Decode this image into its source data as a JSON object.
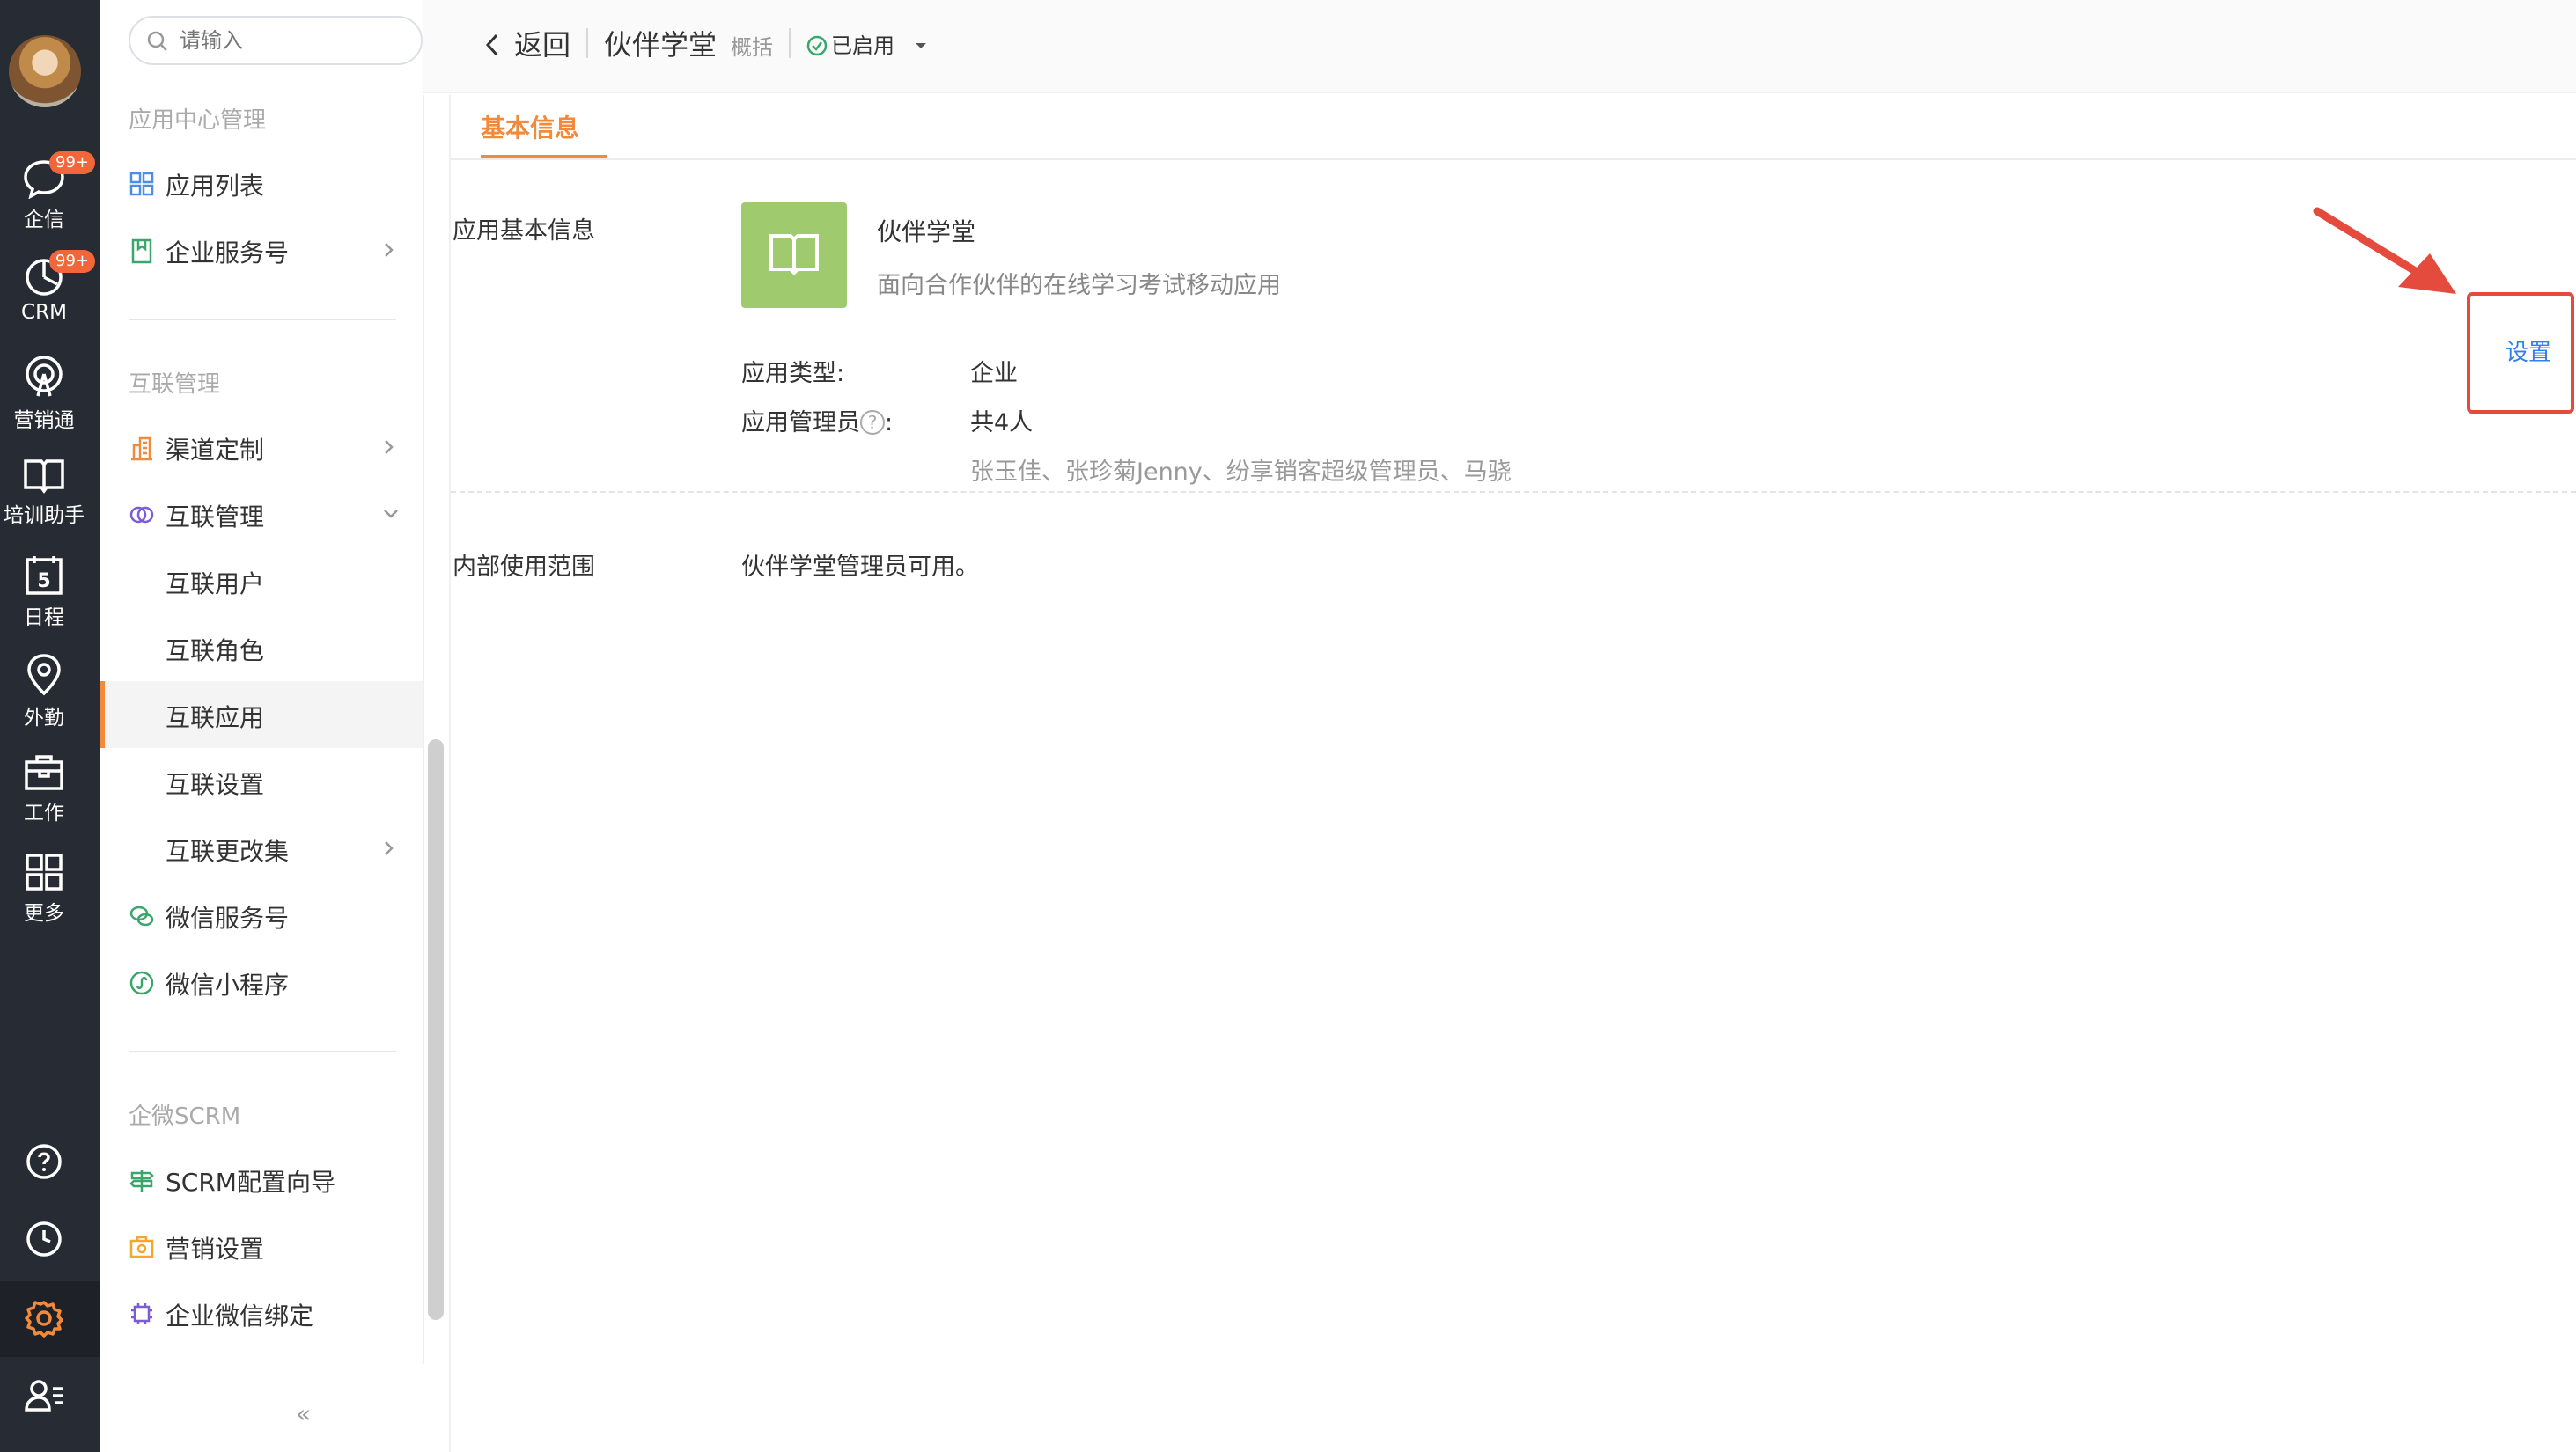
{
  "rail": {
    "items": [
      {
        "label": "企信",
        "badge": "99+",
        "icon": "chat-bubble-icon"
      },
      {
        "label": "CRM",
        "badge": "99+",
        "icon": "pie-clock-icon"
      },
      {
        "label": "营销通",
        "icon": "broadcast-icon"
      },
      {
        "label": "培训助手",
        "icon": "open-book-icon"
      },
      {
        "label": "日程",
        "icon": "calendar-icon",
        "calendar_day": "5"
      },
      {
        "label": "外勤",
        "icon": "location-pin-icon"
      },
      {
        "label": "工作",
        "icon": "briefcase-icon"
      },
      {
        "label": "更多",
        "icon": "grid-icon"
      }
    ]
  },
  "search": {
    "placeholder": "请输入"
  },
  "nav": {
    "section1": "应用中心管理",
    "app_list": "应用列表",
    "enterprise_service": "企业服务号",
    "section2": "互联管理",
    "channel_custom": "渠道定制",
    "interconnect_manage": "互联管理",
    "interconnect_users": "互联用户",
    "interconnect_roles": "互联角色",
    "interconnect_apps": "互联应用",
    "interconnect_settings": "互联设置",
    "interconnect_changeset": "互联更改集",
    "wechat_service": "微信服务号",
    "wechat_miniprogram": "微信小程序",
    "section3": "企微SCRM",
    "scrm_wizard": "SCRM配置向导",
    "marketing_settings": "营销设置",
    "wecom_binding": "企业微信绑定",
    "collapse": "«"
  },
  "header": {
    "back": "返回",
    "app_title": "伙伴学堂",
    "app_sub": "概括",
    "status": "已启用"
  },
  "tabs": {
    "basic_info": "基本信息"
  },
  "content": {
    "basic_label": "应用基本信息",
    "app_name": "伙伴学堂",
    "app_desc": "面向合作伙伴的在线学习考试移动应用",
    "type_key": "应用类型:",
    "type_val": "企业",
    "admin_key": "应用管理员",
    "admin_colon": ":",
    "help_glyph": "?",
    "admin_count": "共4人",
    "admin_names": "张玉佳、张珍菊Jenny、纷享销客超级管理员、马骁",
    "scope_label": "内部使用范围",
    "scope_value": "伙伴学堂管理员可用。",
    "settings_button": "设置"
  },
  "colors": {
    "accent": "#f08a3c",
    "link": "#2f80ed",
    "highlight": "#e54b3c",
    "app_icon_bg": "#9fcb6e",
    "rail_bg": "#272b33"
  }
}
